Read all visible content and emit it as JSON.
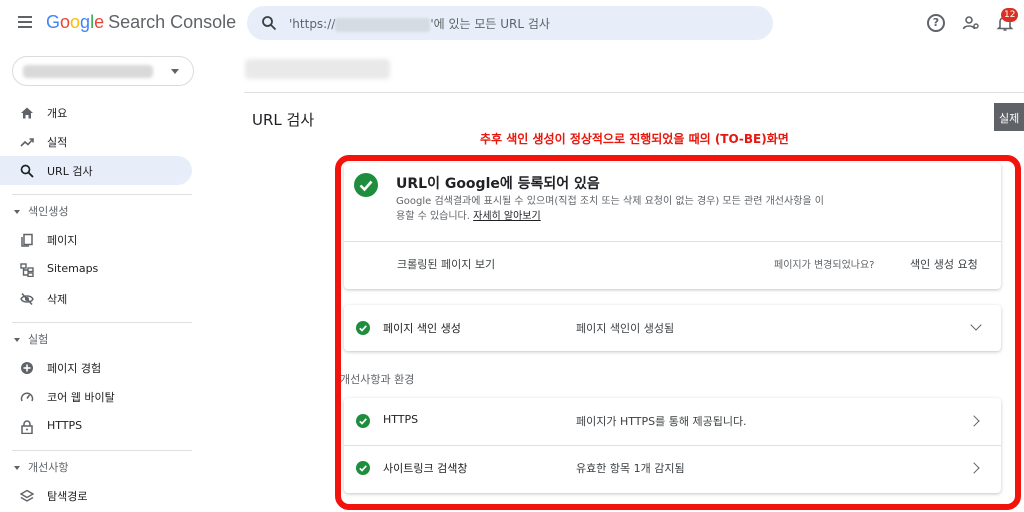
{
  "app": {
    "logo_google": [
      "G",
      "o",
      "o",
      "g",
      "l",
      "e"
    ],
    "logo_product": "Search Console"
  },
  "search": {
    "prefix": "'https://",
    "suffix": "'에 있는 모든 URL 검사"
  },
  "header": {
    "notification_count": "12"
  },
  "sidebar": {
    "items": [
      {
        "label": "개요",
        "icon": "home-icon"
      },
      {
        "label": "실적",
        "icon": "trending-up-icon"
      },
      {
        "label": "URL 검사",
        "icon": "search-icon",
        "active": true
      }
    ],
    "sections": [
      {
        "title": "색인생성",
        "items": [
          {
            "label": "페이지",
            "icon": "pages-icon"
          },
          {
            "label": "Sitemaps",
            "icon": "sitemap-icon"
          },
          {
            "label": "삭제",
            "icon": "eye-off-icon"
          }
        ]
      },
      {
        "title": "실험",
        "items": [
          {
            "label": "페이지 경험",
            "icon": "plus-circle-icon"
          },
          {
            "label": "코어 웹 바이탈",
            "icon": "gauge-icon"
          },
          {
            "label": "HTTPS",
            "icon": "lock-icon"
          }
        ]
      },
      {
        "title": "개선사항",
        "items": [
          {
            "label": "탐색경로",
            "icon": "layers-icon"
          }
        ]
      }
    ]
  },
  "main": {
    "title": "URL 검사",
    "right_tab": "실제",
    "annotation": "추후 색인 생성이 정상적으로 진행되었을 때의 (TO-BE)화면",
    "status_card": {
      "title": "URL이 Google에 등록되어 있음",
      "description": "Google 검색결과에 표시될 수 있으며(직접 조치 또는 삭제 요청이 없는 경우) 모든 관련 개선사항을 이용할 수 있습니다.",
      "learn_more": "자세히 알아보기",
      "crawled_link": "크롤링된 페이지 보기",
      "question": "페이지가 변경되었나요?",
      "request": "색인 생성 요청"
    },
    "indexing_row": {
      "label": "페이지 색인 생성",
      "value": "페이지 색인이 생성됨"
    },
    "enhancements_title": "개선사항과 환경",
    "enhancements": [
      {
        "label": "HTTPS",
        "value": "페이지가 HTTPS를 통해 제공됩니다."
      },
      {
        "label": "사이트링크 검색창",
        "value": "유효한 항목 1개 감지됨"
      }
    ]
  },
  "colors": {
    "accent_red": "#f2140c",
    "success_green": "#1e8e3e",
    "active_nav": "#e8eef9"
  }
}
